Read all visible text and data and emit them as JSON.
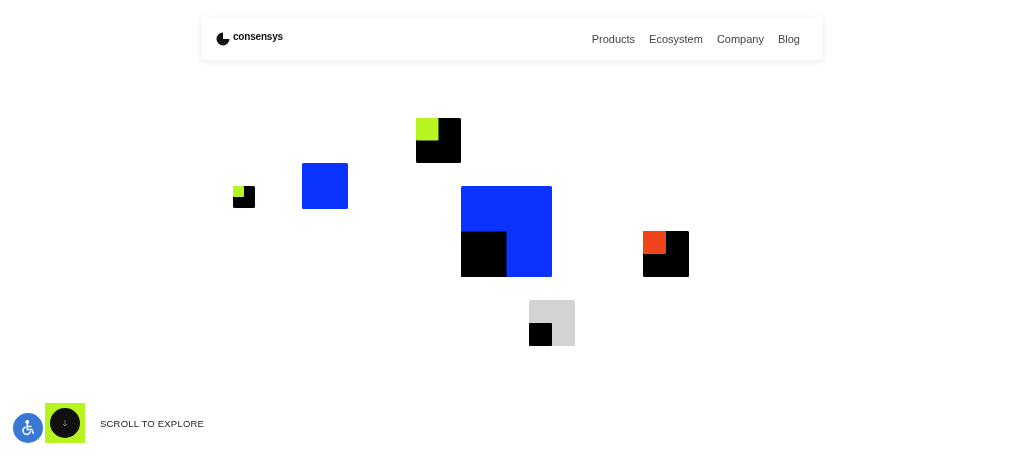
{
  "header": {
    "logo": "consensys",
    "nav": [
      {
        "label": "Products"
      },
      {
        "label": "Ecosystem"
      },
      {
        "label": "Company"
      },
      {
        "label": "Blog"
      }
    ]
  },
  "footer": {
    "scroll_label": "SCROLL TO EXPLORE"
  }
}
